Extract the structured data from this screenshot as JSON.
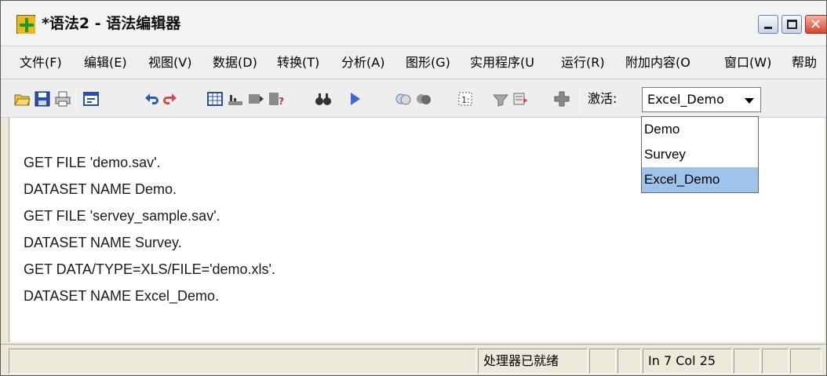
{
  "window": {
    "title": "*语法2 - 语法编辑器"
  },
  "menu": [
    "文件(F)",
    "编辑(E)",
    "视图(V)",
    "数据(D)",
    "转换(T)",
    "分析(A)",
    "图形(G)",
    "实用程序(U",
    "运行(R)",
    "附加内容(O",
    "窗口(W)",
    "帮助"
  ],
  "toolbar": {
    "icons": [
      "open-folder-icon",
      "save-icon",
      "print-icon",
      "dialog-recall-icon",
      "undo-icon",
      "redo-icon",
      "goto-case-icon",
      "variables-icon",
      "insert-cases-icon",
      "split-file-icon",
      "find-icon",
      "run-icon",
      "start-processor-icon",
      "stop-processor-icon",
      "select-cases-icon",
      "value-labels-icon",
      "designate-window-icon",
      "add-icon"
    ],
    "activate_label": "激活:",
    "dataset_selected": "Excel_Demo"
  },
  "dropdown": {
    "options": [
      "Demo",
      "Survey",
      "Excel_Demo"
    ],
    "selected_index": 2
  },
  "editor": {
    "lines": [
      "GET FILE 'demo.sav'.",
      "DATASET NAME Demo.",
      "GET FILE 'servey_sample.sav'.",
      "DATASET NAME Survey.",
      "GET DATA/TYPE=XLS/FILE='demo.xls'.",
      "DATASET NAME Excel_Demo."
    ]
  },
  "status": {
    "processor": "处理器已就绪",
    "position": "In 7 Col 25"
  }
}
